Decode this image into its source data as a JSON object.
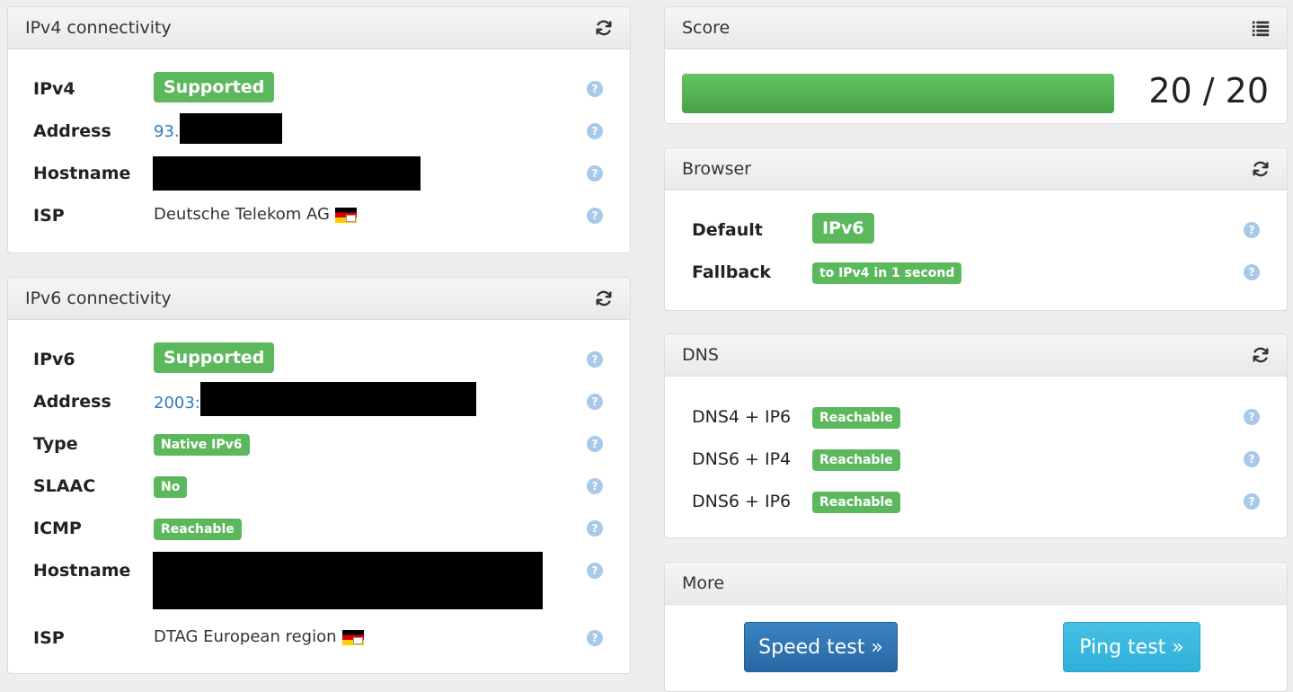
{
  "ipv4": {
    "title": "IPv4 connectivity",
    "refresh_icon": "refresh-icon",
    "rows": [
      {
        "label": "IPv4",
        "badge": "Supported"
      },
      {
        "label": "Address",
        "value": "93."
      },
      {
        "label": "Hostname"
      },
      {
        "label": "ISP",
        "value": "Deutsche Telekom AG"
      }
    ]
  },
  "ipv6": {
    "title": "IPv6 connectivity",
    "rows": [
      {
        "label": "IPv6",
        "badge": "Supported"
      },
      {
        "label": "Address",
        "value": "2003:"
      },
      {
        "label": "Type",
        "badge": "Native IPv6"
      },
      {
        "label": "SLAAC",
        "badge": "No"
      },
      {
        "label": "ICMP",
        "badge": "Reachable"
      },
      {
        "label": "Hostname"
      },
      {
        "label": "ISP",
        "value": "DTAG European region"
      }
    ]
  },
  "score": {
    "title": "Score",
    "list_icon": "list-icon",
    "value": 20,
    "max": 20,
    "text": "20 / 20",
    "bar_color": "#5cb85c"
  },
  "browser": {
    "title": "Browser",
    "rows": [
      {
        "label": "Default",
        "badge": "IPv6"
      },
      {
        "label": "Fallback",
        "badge": "to IPv4 in 1 second"
      }
    ]
  },
  "dns": {
    "title": "DNS",
    "rows": [
      {
        "label": "DNS4 + IP6",
        "badge": "Reachable"
      },
      {
        "label": "DNS6 + IP4",
        "badge": "Reachable"
      },
      {
        "label": "DNS6 + IP6",
        "badge": "Reachable"
      }
    ]
  },
  "more": {
    "title": "More",
    "speed_test": "Speed test »",
    "ping_test": "Ping test »"
  },
  "help_glyph": "?",
  "colors": {
    "success": "#5cb85c",
    "link": "#337ab7",
    "primary": "#2f73b4",
    "info": "#3ab8df"
  }
}
